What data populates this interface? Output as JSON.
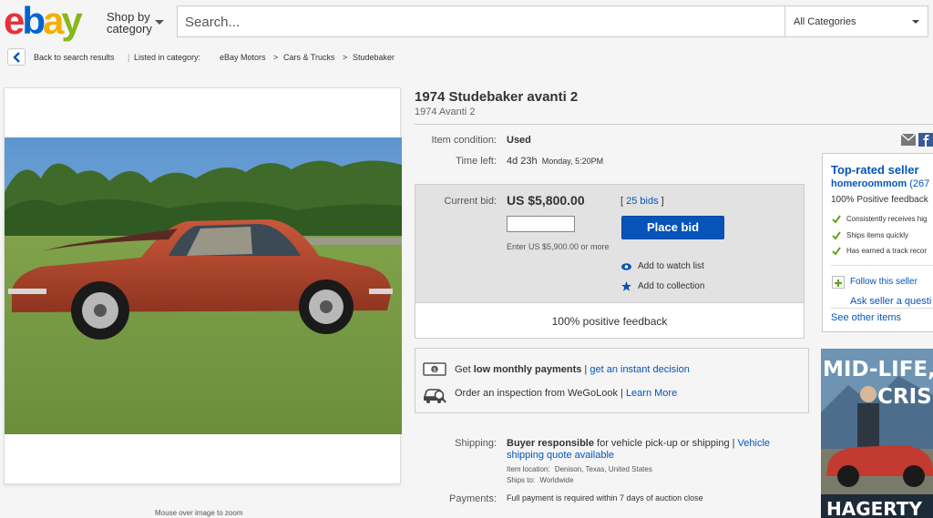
{
  "header": {
    "logo": {
      "e": "e",
      "b": "b",
      "a": "a",
      "y": "y"
    },
    "shop_by_line1": "Shop by",
    "shop_by_line2": "category",
    "search_placeholder": "Search...",
    "category_select": "All Categories"
  },
  "breadcrumb": {
    "back": "Back to search results",
    "separator": "|",
    "listed_in": "Listed in category:",
    "items": [
      "eBay Motors",
      "Cars & Trucks",
      "Studebaker"
    ],
    "arrow": ">"
  },
  "gallery": {
    "zoom_note": "Mouse over image to zoom"
  },
  "item": {
    "title": "1974 Studebaker avanti 2",
    "subtitle": "1974 Avanti 2",
    "condition_label": "Item condition:",
    "condition_value": "Used",
    "time_left_label": "Time left:",
    "time_left_value": "4d 23h",
    "time_left_end": "Monday, 5:20PM"
  },
  "bid": {
    "current_bid_label": "Current bid:",
    "current_bid_value": "US $5,800.00",
    "bids_prefix": "[",
    "bids_count": "25 bids",
    "bids_suffix": "]",
    "place_bid": "Place bid",
    "enter_hint": "Enter US $5,900.00 or more",
    "watch_list": "Add to watch list",
    "collection": "Add to collection",
    "feedback": "100% positive feedback"
  },
  "payments": {
    "monthly_prefix": "Get ",
    "monthly_bold": "low monthly payments",
    "monthly_sep": " | ",
    "monthly_link": "get an instant decision",
    "inspection_text": "Order an inspection from WeGoLook",
    "inspection_sep": " | ",
    "inspection_link": "Learn More"
  },
  "shipping": {
    "label": "Shipping:",
    "bold": "Buyer responsible",
    "text": " for vehicle pick-up or shipping ",
    "sep": " | ",
    "link_line1": "Vehicle",
    "link_line2": "shipping quote available",
    "location_label": "Item location:",
    "location_value": "Denison, Texas, United States",
    "ships_label": "Ships to:",
    "ships_value": "Worldwide"
  },
  "payments_row": {
    "label": "Payments:",
    "value": "Full payment is required within 7 days of auction close"
  },
  "seller": {
    "top_rated": "Top-rated seller",
    "name": "homeroommom",
    "score": "(267",
    "positive": "100% Positive feedback",
    "features": [
      "Consistently receives hig",
      "Ships items quickly",
      "Has earned a track recor"
    ],
    "follow": "Follow this seller",
    "ask": "Ask seller a questi",
    "see_other": "See other items"
  },
  "ad": {
    "line1": "MID-LIFE,",
    "line2": "CRISI",
    "brand": "HAGERTY"
  },
  "colors": {
    "link": "#0654ba",
    "button": "#0654ba",
    "check": "#5ba71b",
    "car": "#b4472a"
  }
}
